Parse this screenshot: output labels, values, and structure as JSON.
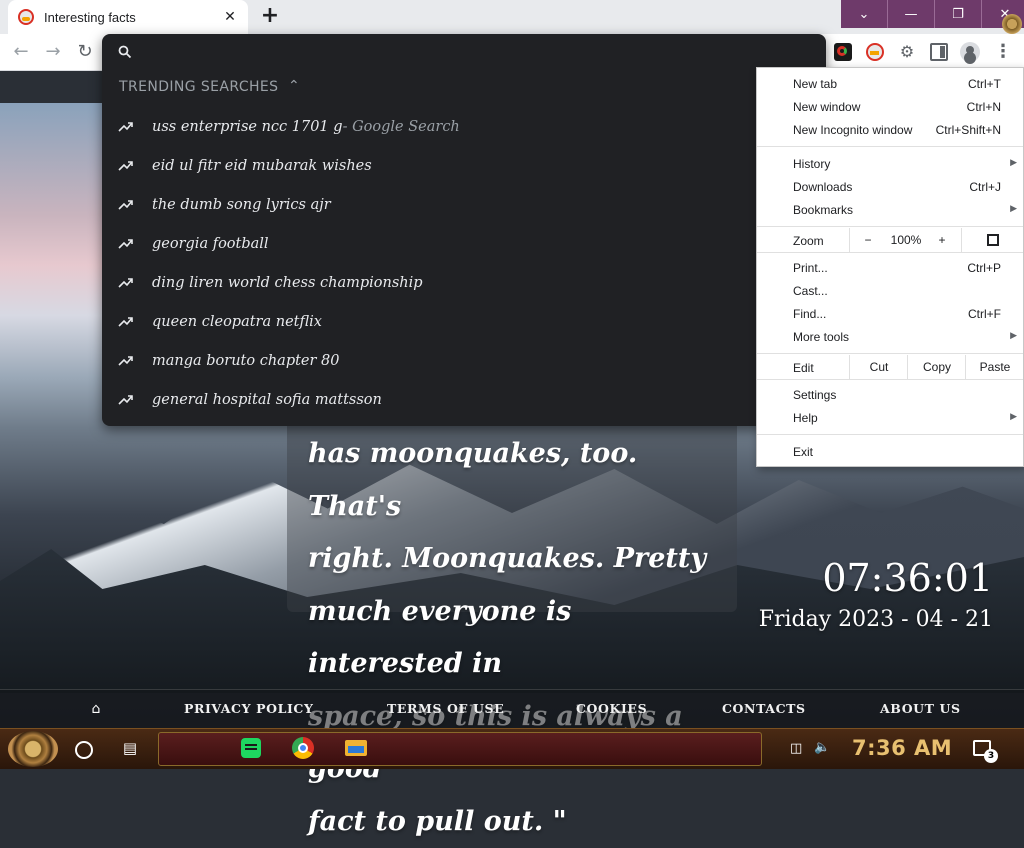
{
  "browser": {
    "tab": {
      "title": "Interesting facts",
      "close_icon": "close-icon"
    },
    "new_tab_label": "+",
    "window_controls": [
      "chevron-down-icon",
      "minimize-icon",
      "restore-icon",
      "close-icon"
    ],
    "toolbar_icons": [
      "back-arrow-icon",
      "forward-arrow-icon",
      "reload-icon"
    ]
  },
  "omnibox": {
    "input_value": "",
    "trending_header": "TRENDING SEARCHES",
    "suggestions": [
      {
        "text": "uss enterprise ncc 1701 g",
        "suffix": " - Google Search"
      },
      {
        "text": "eid ul fitr eid mubarak wishes",
        "suffix": ""
      },
      {
        "text": "the dumb song lyrics ajr",
        "suffix": ""
      },
      {
        "text": "georgia football",
        "suffix": ""
      },
      {
        "text": "ding liren world chess championship",
        "suffix": ""
      },
      {
        "text": "queen cleopatra netflix",
        "suffix": ""
      },
      {
        "text": "manga boruto chapter 80",
        "suffix": ""
      },
      {
        "text": "general hospital sofia mattsson",
        "suffix": ""
      }
    ]
  },
  "menu": {
    "new_tab": {
      "label": "New tab",
      "shortcut": "Ctrl+T"
    },
    "new_window": {
      "label": "New window",
      "shortcut": "Ctrl+N"
    },
    "new_incognito": {
      "label": "New Incognito window",
      "shortcut": "Ctrl+Shift+N"
    },
    "history": {
      "label": "History"
    },
    "downloads": {
      "label": "Downloads",
      "shortcut": "Ctrl+J"
    },
    "bookmarks": {
      "label": "Bookmarks"
    },
    "zoom": {
      "label": "Zoom",
      "minus": "−",
      "value": "100%",
      "plus": "+"
    },
    "print": {
      "label": "Print...",
      "shortcut": "Ctrl+P"
    },
    "cast": {
      "label": "Cast..."
    },
    "find": {
      "label": "Find...",
      "shortcut": "Ctrl+F"
    },
    "more_tools": {
      "label": "More tools"
    },
    "edit": {
      "label": "Edit",
      "cut": "Cut",
      "copy": "Copy",
      "paste": "Paste"
    },
    "settings": {
      "label": "Settings"
    },
    "help": {
      "label": "Help"
    },
    "exit": {
      "label": "Exit"
    }
  },
  "page": {
    "quote_lines": [
      "has moonquakes, too. That's",
      "right. Moonquakes. Pretty",
      "much everyone is interested in",
      "space, so this is always a good",
      "fact to pull out.  \""
    ],
    "clock_time": "07:36:01",
    "clock_date": "Friday 2023 - 04 - 21",
    "footer_links": [
      "PRIVACY POLICY",
      "TERMS OF USE",
      "COOKIES",
      "CONTACTS",
      "ABOUT US"
    ]
  },
  "taskbar": {
    "clock": "7:36 AM",
    "notification_count": "3"
  }
}
